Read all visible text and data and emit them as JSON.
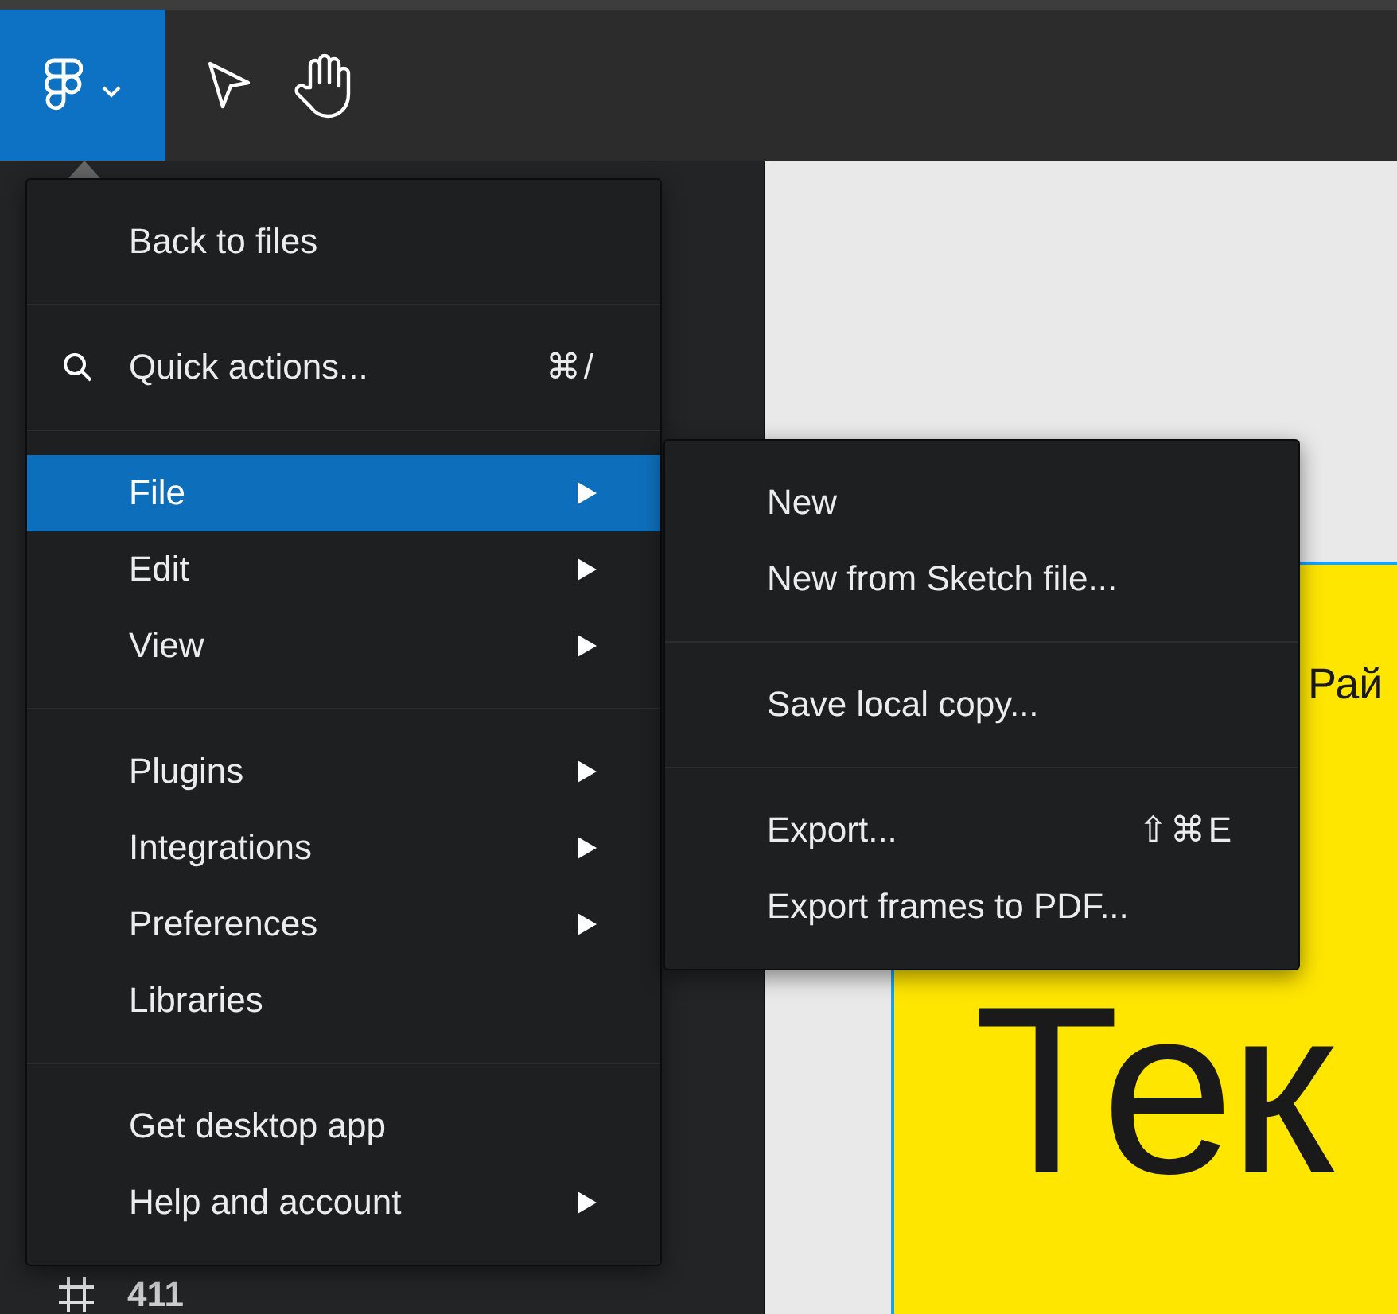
{
  "toolbar": {
    "main_menu_button": {
      "expanded": true
    },
    "tools": [
      {
        "kind": "move",
        "selected": false
      },
      {
        "kind": "hand",
        "selected": false
      }
    ]
  },
  "main_menu": {
    "sections": [
      {
        "items": [
          {
            "label": "Back to files",
            "has_submenu": false,
            "selected": false
          }
        ]
      },
      {
        "items": [
          {
            "label": "Quick actions...",
            "kind": "search",
            "shortcut": "⌘/",
            "has_submenu": false,
            "selected": false
          }
        ]
      },
      {
        "items": [
          {
            "label": "File",
            "has_submenu": true,
            "selected": true
          },
          {
            "label": "Edit",
            "has_submenu": true,
            "selected": false
          },
          {
            "label": "View",
            "has_submenu": true,
            "selected": false
          }
        ]
      },
      {
        "items": [
          {
            "label": "Plugins",
            "has_submenu": true,
            "selected": false
          },
          {
            "label": "Integrations",
            "has_submenu": true,
            "selected": false
          },
          {
            "label": "Preferences",
            "has_submenu": true,
            "selected": false
          },
          {
            "label": "Libraries",
            "has_submenu": false,
            "selected": false
          }
        ]
      },
      {
        "items": [
          {
            "label": "Get desktop app",
            "has_submenu": false,
            "selected": false
          },
          {
            "label": "Help and account",
            "has_submenu": true,
            "selected": false
          }
        ]
      }
    ]
  },
  "file_submenu": {
    "sections": [
      {
        "items": [
          {
            "label": "New",
            "has_submenu": false,
            "selected": false
          },
          {
            "label": "New from Sketch file...",
            "has_submenu": false,
            "selected": false
          }
        ]
      },
      {
        "items": [
          {
            "label": "Save local copy...",
            "has_submenu": false,
            "selected": false
          }
        ]
      },
      {
        "items": [
          {
            "label": "Export...",
            "shortcut": "⇧⌘E",
            "has_submenu": false,
            "selected": false
          },
          {
            "label": "Export frames to PDF...",
            "has_submenu": false,
            "selected": false
          }
        ]
      }
    ]
  },
  "layers": [
    {
      "name": "411"
    }
  ],
  "canvas": {
    "frame_texts": [
      {
        "kind": "small",
        "text": "Рай"
      },
      {
        "kind": "heading",
        "text": "Тек"
      }
    ]
  }
}
